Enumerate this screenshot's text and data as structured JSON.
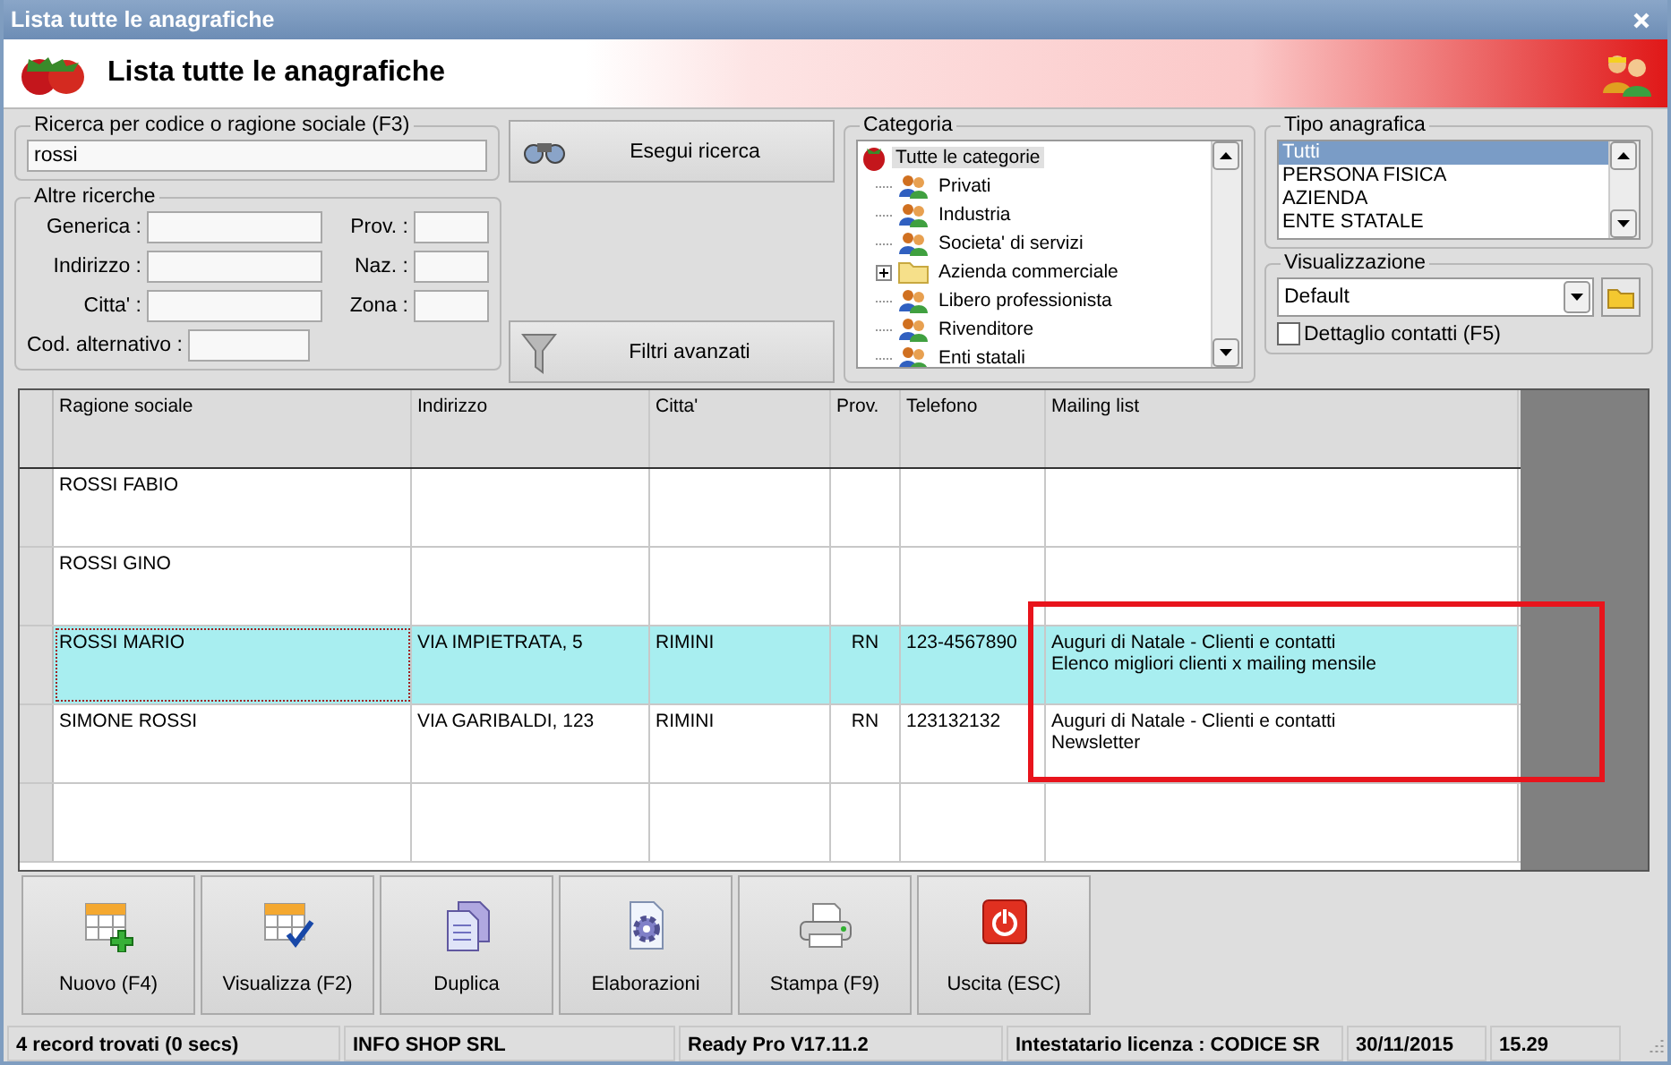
{
  "window": {
    "title": "Lista tutte le anagrafiche"
  },
  "header": {
    "title": "Lista tutte le anagrafiche"
  },
  "search": {
    "label": "Ricerca per codice o ragione sociale (F3)",
    "value": "rossi",
    "button": "Esegui ricerca"
  },
  "other_searches": {
    "label": "Altre ricerche",
    "left_fields": [
      {
        "label": "Generica :"
      },
      {
        "label": "Indirizzo :"
      },
      {
        "label": "Citta' :"
      }
    ],
    "right_fields": [
      {
        "label": "Prov. :"
      },
      {
        "label": "Naz. :"
      },
      {
        "label": "Zona :"
      }
    ],
    "extra_field": {
      "label": "Cod. alternativo :"
    }
  },
  "advanced_filters": {
    "button": "Filtri avanzati"
  },
  "category": {
    "label": "Categoria",
    "root": {
      "label": "Tutte le categorie",
      "selected": true
    },
    "children": [
      {
        "label": "Privati",
        "selected": false,
        "kind": "group",
        "has_children": false
      },
      {
        "label": "Industria",
        "selected": false,
        "kind": "group",
        "has_children": false
      },
      {
        "label": "Societa' di servizi",
        "selected": false,
        "kind": "group",
        "has_children": false
      },
      {
        "label": "Azienda commerciale",
        "selected": false,
        "kind": "folder",
        "has_children": true
      },
      {
        "label": "Libero professionista",
        "selected": false,
        "kind": "group",
        "has_children": false
      },
      {
        "label": "Rivenditore",
        "selected": false,
        "kind": "group",
        "has_children": false
      },
      {
        "label": "Enti statali",
        "selected": false,
        "kind": "group",
        "has_children": false
      }
    ]
  },
  "type": {
    "label": "Tipo anagrafica",
    "items": [
      {
        "label": "Tutti",
        "selected": true
      },
      {
        "label": "PERSONA FISICA",
        "selected": false
      },
      {
        "label": "AZIENDA",
        "selected": false
      },
      {
        "label": "ENTE STATALE",
        "selected": false
      }
    ]
  },
  "view": {
    "label": "Visualizzazione",
    "value": "Default",
    "checkbox": {
      "label": "Dettaglio contatti (F5)",
      "checked": false
    }
  },
  "table": {
    "columns": [
      "Ragione sociale",
      "Indirizzo",
      "Citta'",
      "Prov.",
      "Telefono",
      "Mailing list"
    ],
    "rows": [
      {
        "selected": false,
        "ragione_sociale": "ROSSI FABIO"
      },
      {
        "selected": false,
        "ragione_sociale": "ROSSI GINO"
      },
      {
        "selected": true,
        "ragione_sociale": "ROSSI MARIO",
        "indirizzo": "VIA IMPIETRATA, 5",
        "citta": "RIMINI",
        "prov": "RN",
        "telefono": "123-4567890",
        "mailing_list": [
          "Auguri di Natale - Clienti e contatti",
          "Elenco migliori clienti x mailing mensile"
        ]
      },
      {
        "selected": false,
        "ragione_sociale": "SIMONE ROSSI",
        "indirizzo": "VIA GARIBALDI, 123",
        "citta": "RIMINI",
        "prov": "RN",
        "telefono": "123132132",
        "mailing_list": [
          "Auguri di Natale - Clienti e contatti",
          "Newsletter"
        ]
      },
      {
        "selected": false
      }
    ]
  },
  "buttons": [
    {
      "label": "Nuovo (F4)",
      "kind": "new"
    },
    {
      "label": "Visualizza (F2)",
      "kind": "view"
    },
    {
      "label": "Duplica",
      "kind": "duplicate"
    },
    {
      "label": "Elaborazioni",
      "kind": "process"
    },
    {
      "label": "Stampa (F9)",
      "kind": "print"
    },
    {
      "label": "Uscita (ESC)",
      "kind": "exit"
    }
  ],
  "status_bar": [
    "4 record trovati (0 secs)",
    "INFO SHOP SRL",
    "Ready Pro V17.11.2",
    "Intestatario licenza : CODICE SR",
    "30/11/2015",
    "15.29"
  ]
}
